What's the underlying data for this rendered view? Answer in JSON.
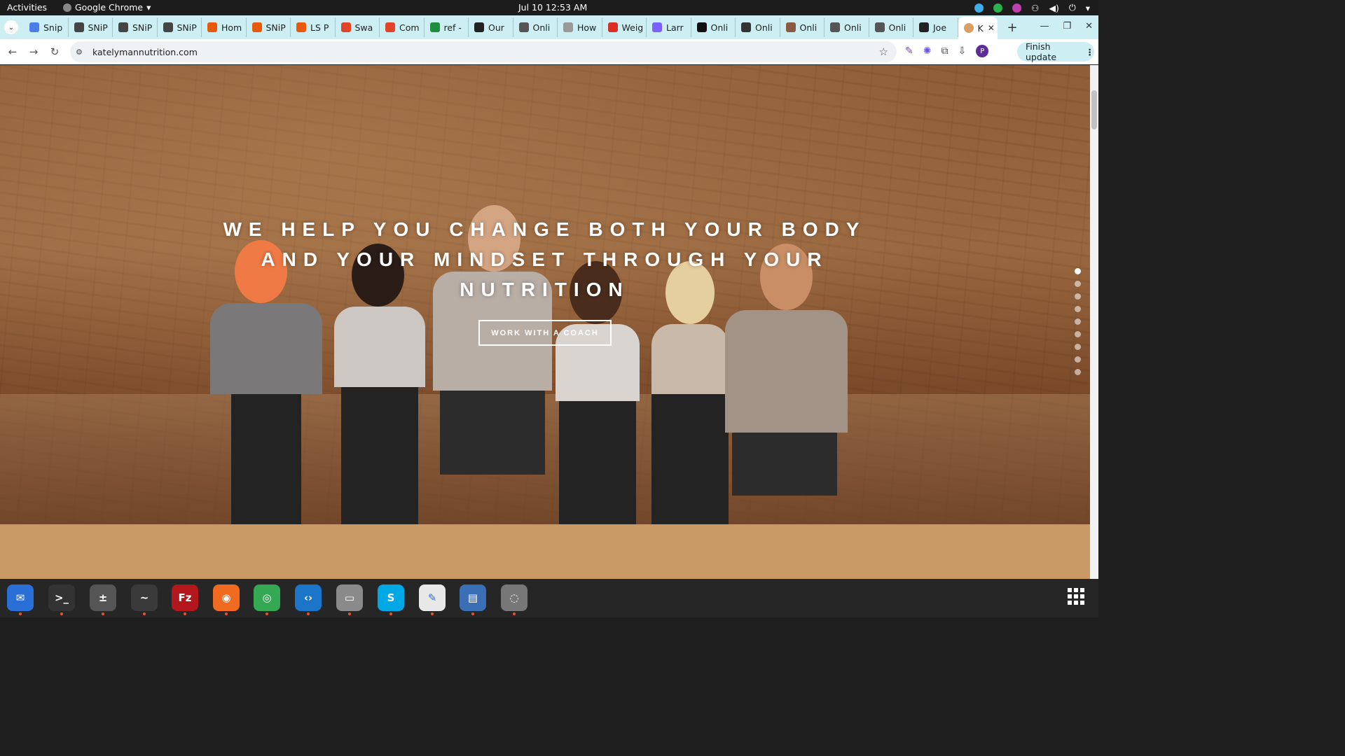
{
  "system_bar": {
    "activities": "Activities",
    "app_name": "Google Chrome",
    "clock": "Jul 10  12:53 AM"
  },
  "browser": {
    "tabs": [
      {
        "label": "Snip",
        "color": "#4a7ee8"
      },
      {
        "label": "SNiP",
        "color": "#444444"
      },
      {
        "label": "SNiP",
        "color": "#444444"
      },
      {
        "label": "SNiP",
        "color": "#444444"
      },
      {
        "label": "Hom",
        "color": "#e8590c"
      },
      {
        "label": "SNiP",
        "color": "#e8590c"
      },
      {
        "label": "LS P",
        "color": "#e8590c"
      },
      {
        "label": "Swa",
        "color": "#e24329"
      },
      {
        "label": "Com",
        "color": "#e24329"
      },
      {
        "label": "ref -",
        "color": "#1e8e3e"
      },
      {
        "label": "Our",
        "color": "#222222"
      },
      {
        "label": "Onli",
        "color": "#555555"
      },
      {
        "label": "How",
        "color": "#999999"
      },
      {
        "label": "Weig",
        "color": "#d93025"
      },
      {
        "label": "Larr",
        "color": "#7b61ff"
      },
      {
        "label": "Onli",
        "color": "#111111"
      },
      {
        "label": "Onli",
        "color": "#333333"
      },
      {
        "label": "Onli",
        "color": "#8a5a44"
      },
      {
        "label": "Onli",
        "color": "#555555"
      },
      {
        "label": "Onli",
        "color": "#555555"
      },
      {
        "label": "Joe",
        "color": "#222222"
      }
    ],
    "active_tab": {
      "label": "K",
      "color": "#d9a066"
    },
    "url": "katelymannutrition.com",
    "finish_update": "Finish update",
    "profile_initial": "P"
  },
  "page": {
    "headline": "WE HELP YOU CHANGE BOTH YOUR BODY AND YOUR MINDSET THROUGH YOUR NUTRITION",
    "cta_label": "WORK WITH A COACH",
    "slide_count": 9,
    "active_slide": 1,
    "band_color": "#c99a66"
  },
  "dock": {
    "apps": [
      {
        "name": "thunderbird",
        "color": "#2a6fd6",
        "glyph": "✉"
      },
      {
        "name": "terminal",
        "color": "#333333",
        "glyph": ">_"
      },
      {
        "name": "calculator",
        "color": "#555555",
        "glyph": "±"
      },
      {
        "name": "system-monitor",
        "color": "#3a3a3a",
        "glyph": "~"
      },
      {
        "name": "filezilla",
        "color": "#b3171b",
        "glyph": "Fz"
      },
      {
        "name": "firefox",
        "color": "#f06b1f",
        "glyph": "◉"
      },
      {
        "name": "chrome",
        "color": "#34a853",
        "glyph": "◎"
      },
      {
        "name": "vscode",
        "color": "#1b75c9",
        "glyph": "‹›"
      },
      {
        "name": "files",
        "color": "#8a8a8a",
        "glyph": "▭"
      },
      {
        "name": "skype",
        "color": "#00a9e6",
        "glyph": "S"
      },
      {
        "name": "text-editor",
        "color": "#e8e8e8",
        "glyph": "✎"
      },
      {
        "name": "document-viewer",
        "color": "#3b6fb5",
        "glyph": "▤"
      },
      {
        "name": "disk",
        "color": "#777777",
        "glyph": "◌"
      }
    ]
  }
}
